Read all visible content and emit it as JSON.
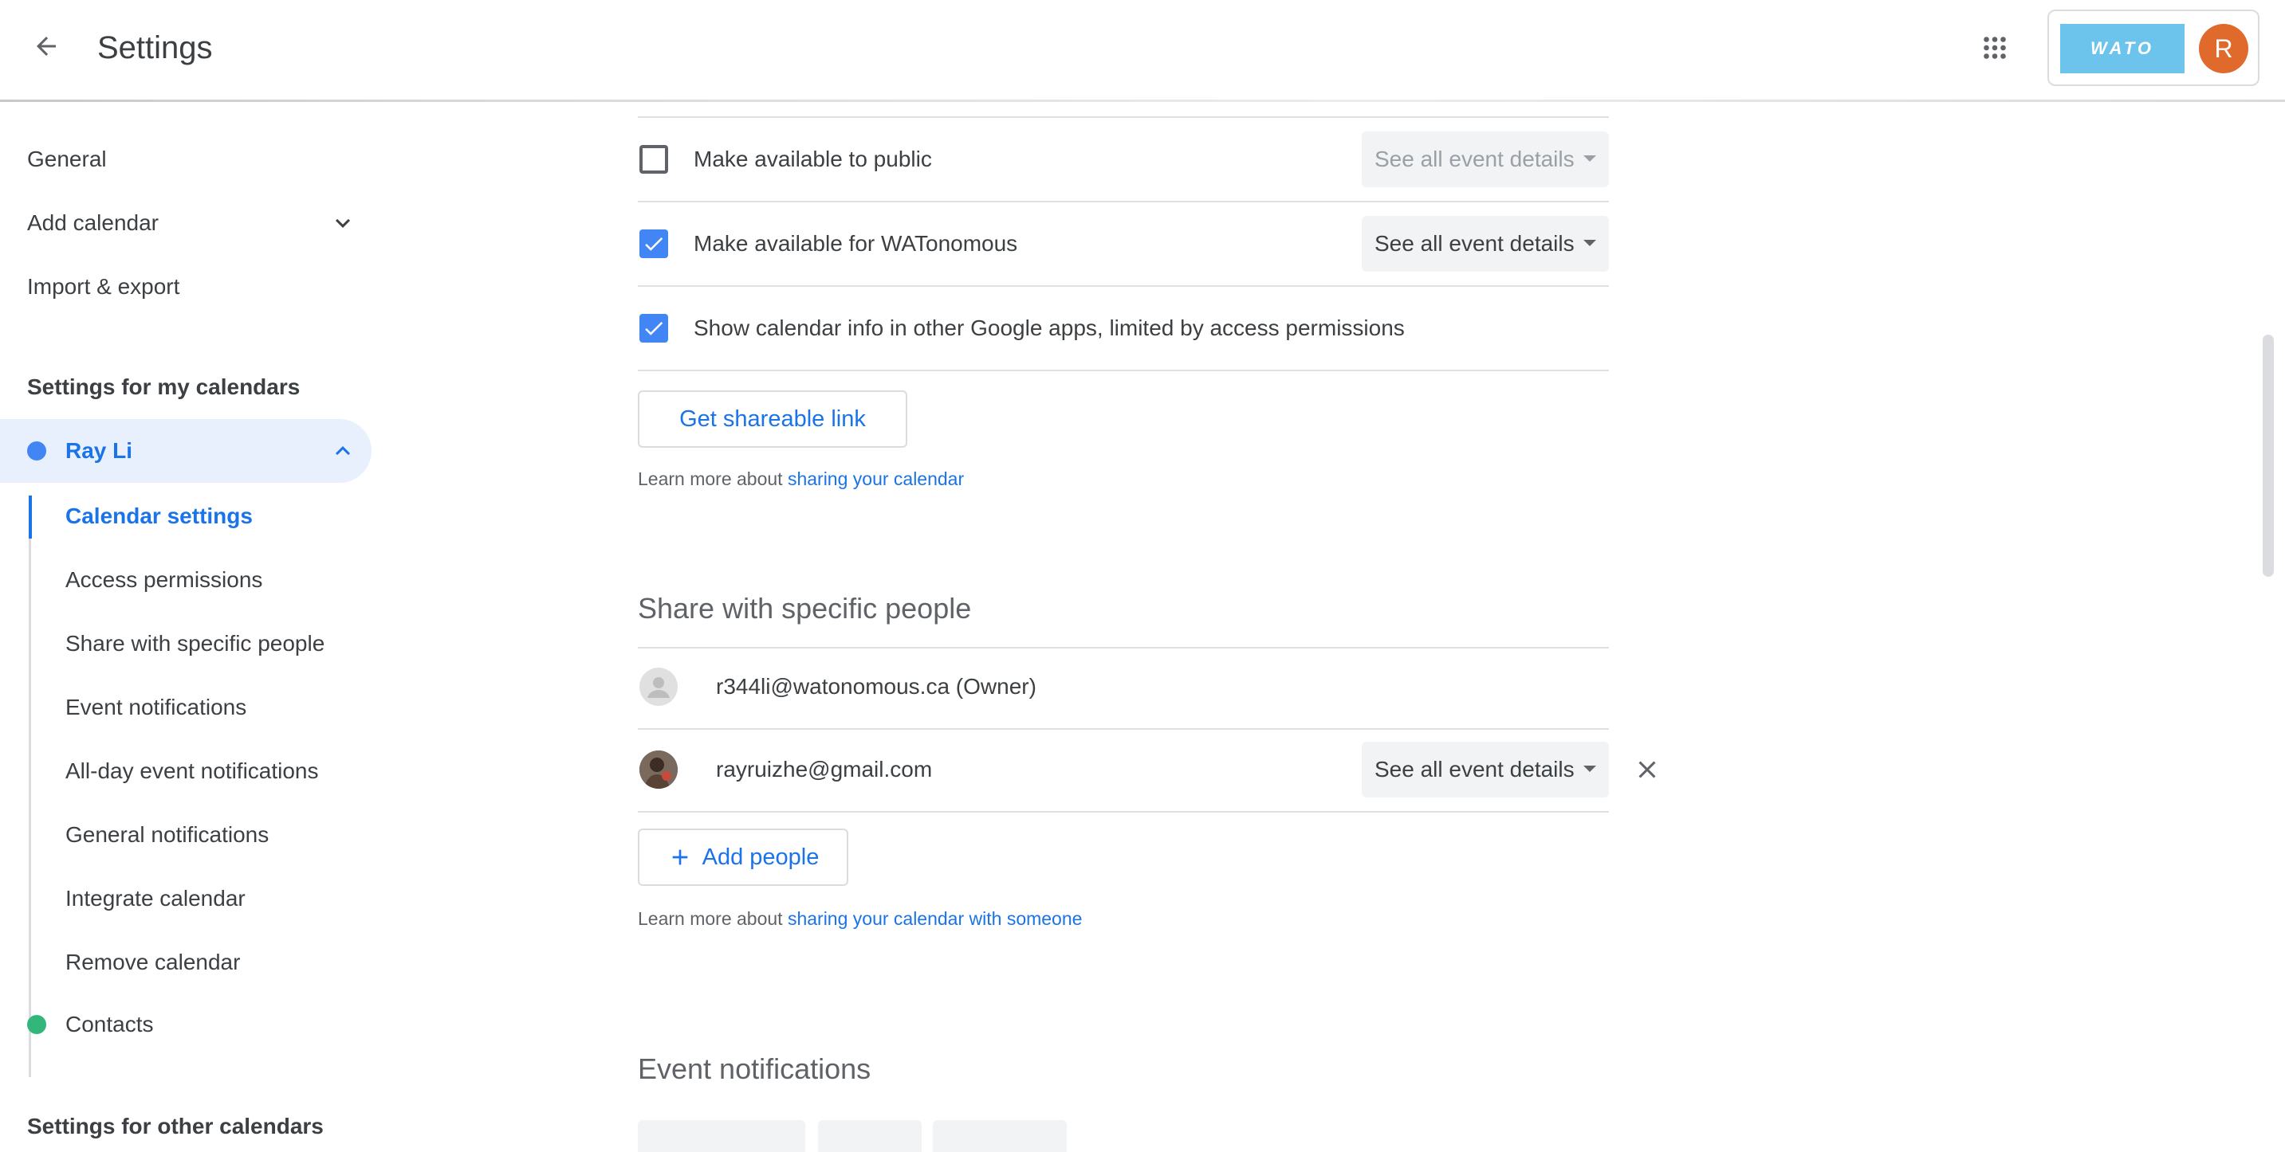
{
  "header": {
    "title": "Settings",
    "back_icon": "arrow-left-icon",
    "apps_icon": "apps-grid-icon",
    "org_logo_text": "WATO",
    "avatar_letter": "R",
    "colors": {
      "avatar": "#e06a2c",
      "org_logo": "#6cc4ec"
    }
  },
  "sidebar": {
    "general": "General",
    "add_calendar": "Add calendar",
    "import_export": "Import & export",
    "my_calendars_heading": "Settings for my calendars",
    "my_calendar": {
      "name": "Ray Li",
      "color": "#4285f4",
      "expanded": true
    },
    "sub_items": [
      "Calendar settings",
      "Access permissions",
      "Share with specific people",
      "Event notifications",
      "All-day event notifications",
      "General notifications",
      "Integrate calendar",
      "Remove calendar"
    ],
    "active_sub_item": "Calendar settings",
    "contacts": {
      "name": "Contacts",
      "color": "#33b679"
    },
    "other_calendars_heading": "Settings for other calendars"
  },
  "access": {
    "public": {
      "label": "Make available to public",
      "checked": false,
      "select": "See all event details"
    },
    "org": {
      "label": "Make available for WATonomous",
      "checked": true,
      "select": "See all event details"
    },
    "google_apps": {
      "label": "Show calendar info in other Google apps, limited by access permissions",
      "checked": true
    },
    "shareable_link_button": "Get shareable link",
    "help_prefix": "Learn more about ",
    "help_link": "sharing your calendar"
  },
  "share": {
    "title": "Share with specific people",
    "people": [
      {
        "email": "r344li@watonomous.ca (Owner)"
      },
      {
        "email": "rayruizhe@gmail.com",
        "permission": "See all event details"
      }
    ],
    "add_people_button": "Add people",
    "help_prefix": "Learn more about ",
    "help_link": "sharing your calendar with someone"
  },
  "event_notifications": {
    "title": "Event notifications"
  },
  "colors": {
    "accent": "#1a73e8",
    "checkbox": "#4285f4"
  }
}
